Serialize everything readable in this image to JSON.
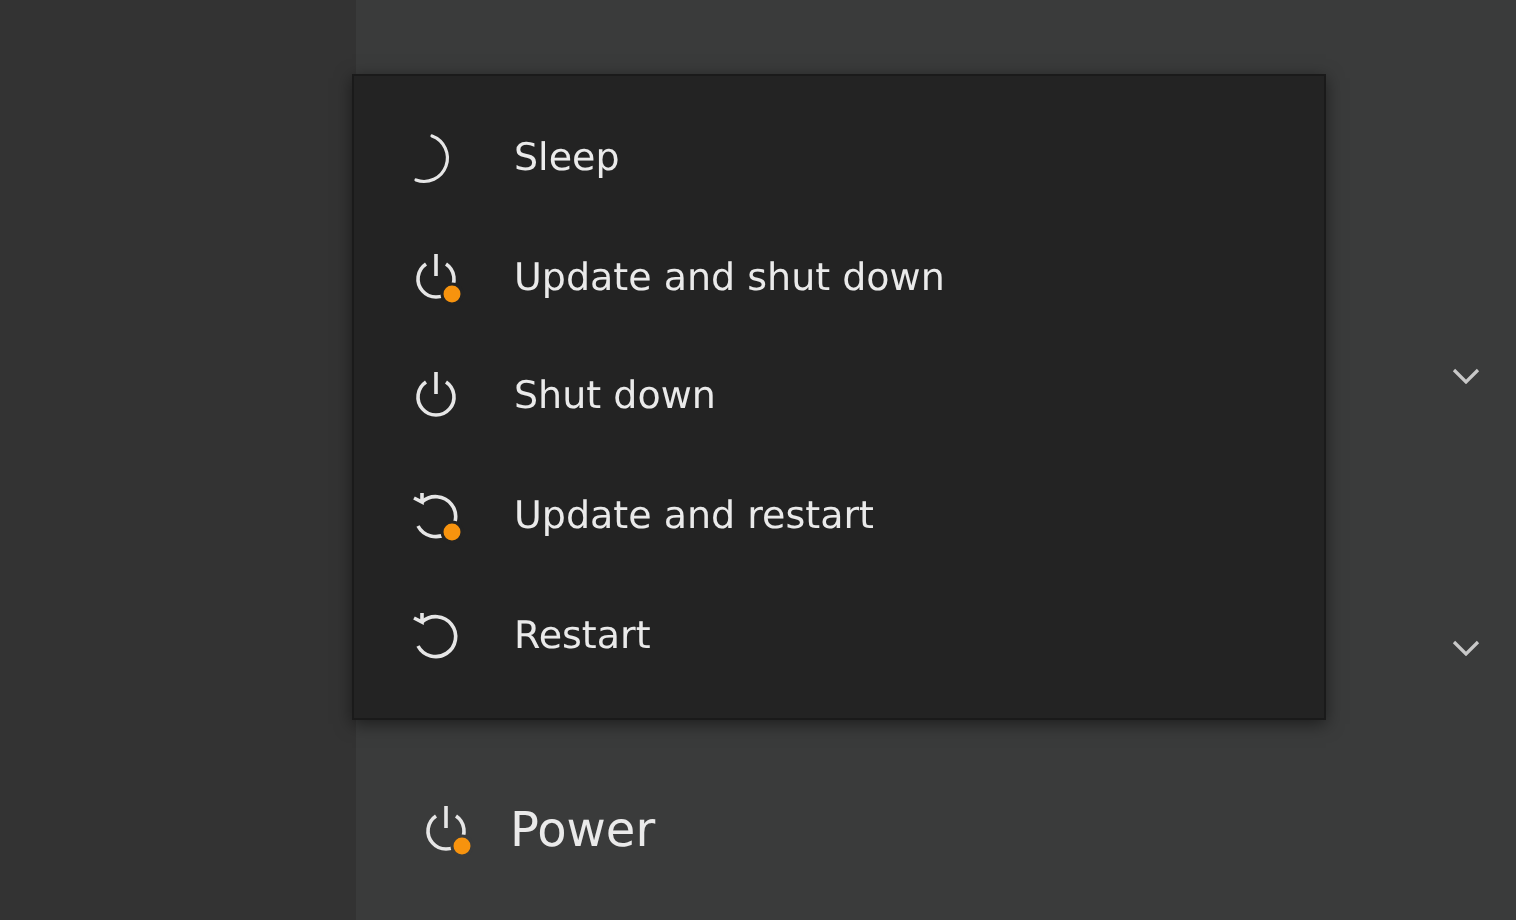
{
  "panel": {
    "expanders": [
      {
        "expanded": false
      },
      {
        "expanded": false
      }
    ],
    "power": {
      "label": "Power",
      "pending_update": true
    }
  },
  "power_menu": {
    "items": [
      {
        "label": "Sleep",
        "kind": "sleep",
        "pending_update": false
      },
      {
        "label": "Update and shut down",
        "kind": "shutdown",
        "pending_update": true
      },
      {
        "label": "Shut down",
        "kind": "shutdown",
        "pending_update": false
      },
      {
        "label": "Update and restart",
        "kind": "restart",
        "pending_update": true
      },
      {
        "label": "Restart",
        "kind": "restart",
        "pending_update": false
      }
    ]
  }
}
